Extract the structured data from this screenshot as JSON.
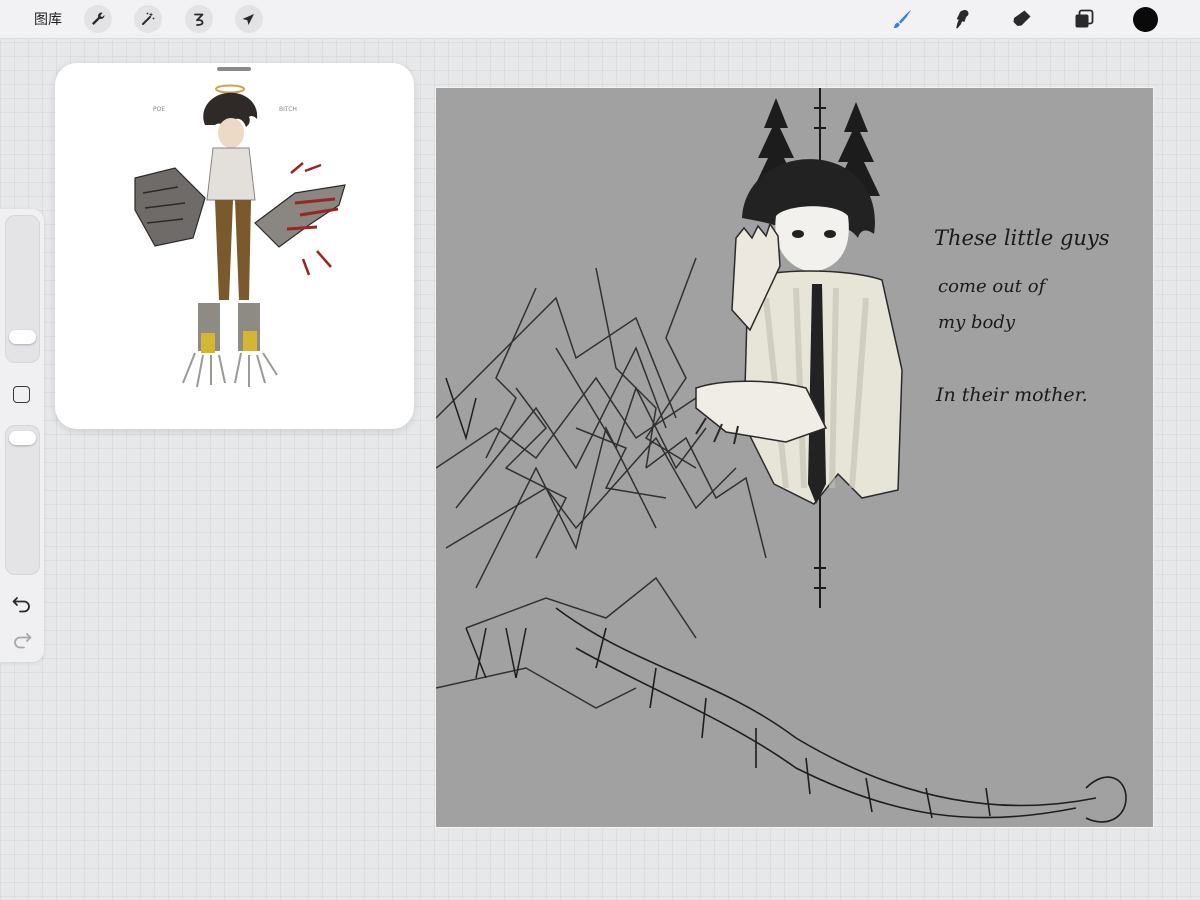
{
  "toolbar": {
    "gallery_label": "图库",
    "left_tools": [
      "wrench-icon",
      "magic-wand-icon",
      "selection-icon",
      "transform-arrow-icon"
    ],
    "right_tools": [
      "brush-icon",
      "smudge-icon",
      "eraser-icon",
      "layers-icon"
    ],
    "active_tool": "brush-icon",
    "active_color": "#000000",
    "accent": "#2f7ef6"
  },
  "reference": {
    "label_left": "POE",
    "label_right": "BITCH"
  },
  "sidebar": {
    "brush_size_level": 0.73,
    "opacity_level": 0.05
  },
  "canvas": {
    "background": "#a1a1a1",
    "caption_line1": "These little guys",
    "caption_line2": "come out of",
    "caption_line3": "my body",
    "caption_line4": "In their mother."
  }
}
